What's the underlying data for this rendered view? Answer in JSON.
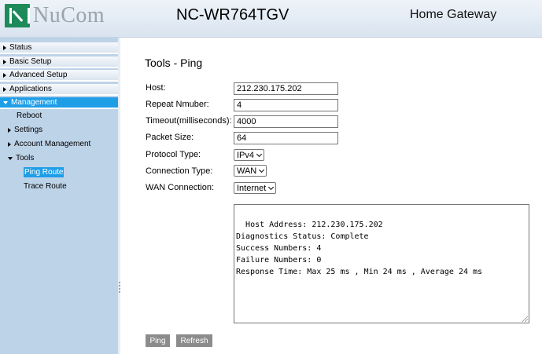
{
  "header": {
    "brand": "NuCom",
    "model": "NC-WR764TGV",
    "product": "Home Gateway"
  },
  "sidebar": {
    "menus": [
      {
        "label": "Status"
      },
      {
        "label": "Basic Setup"
      },
      {
        "label": "Advanced Setup"
      },
      {
        "label": "Applications"
      },
      {
        "label": "Management"
      }
    ],
    "management_items": {
      "reboot": "Reboot",
      "settings": "Settings",
      "account": "Account Management",
      "tools": "Tools",
      "ping_route": "Ping Route",
      "trace_route": "Trace Route"
    },
    "active_color": "#1f9ee8"
  },
  "page": {
    "title": "Tools - Ping",
    "host_label": "Host:",
    "host_value": "212.230.175.202",
    "repeat_label": "Repeat Nmuber:",
    "repeat_value": "4",
    "timeout_label": "Timeout(milliseconds):",
    "timeout_value": "4000",
    "packet_label": "Packet Size:",
    "packet_value": "64",
    "protocol_label": "Protocol Type:",
    "protocol_value": "IPv4",
    "conntype_label": "Connection Type:",
    "conntype_value": "WAN",
    "wanconn_label": "WAN Connection:",
    "wanconn_value": "Internet",
    "result": "Host Address: 212.230.175.202\nDiagnostics Status: Complete\nSuccess Numbers: 4\nFailure Numbers: 0\nResponse Time: Max 25 ms , Min 24 ms , Average 24 ms",
    "ping_button": "Ping",
    "refresh_button": "Refresh"
  }
}
